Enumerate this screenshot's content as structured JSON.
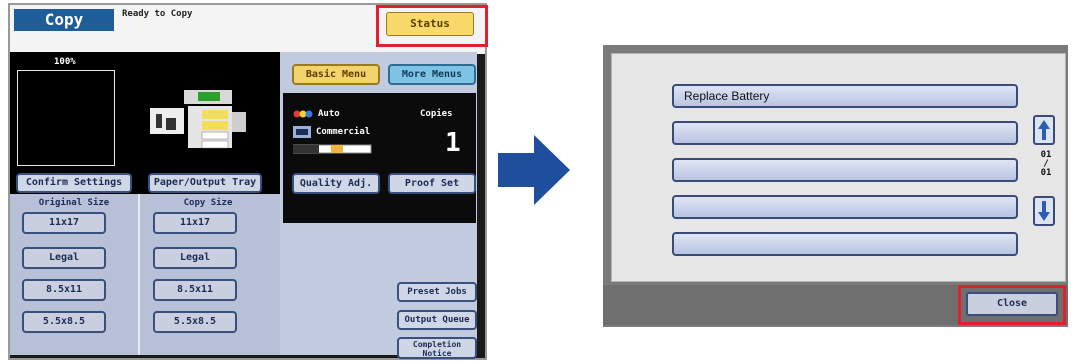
{
  "left_screen": {
    "title": "Copy",
    "status_text": "Ready to Copy",
    "status_button": "Status",
    "zoom": "100%",
    "confirm_settings": "Confirm Settings",
    "paper_output_tray": "Paper/Output Tray",
    "original_size_header": "Original Size",
    "copy_size_header": "Copy Size",
    "original_sizes": [
      "11x17",
      "Legal",
      "8.5x11",
      "5.5x8.5"
    ],
    "copy_sizes": [
      "11x17",
      "Legal",
      "8.5x11",
      "5.5x8.5"
    ],
    "basic_menu": "Basic Menu",
    "more_menus": "More Menus",
    "color_mode": "Auto",
    "paper_type": "Commercial",
    "copies_label": "Copies",
    "copies_value": "1",
    "quality_adj": "Quality Adj.",
    "proof_set": "Proof Set",
    "preset_jobs": "Preset Jobs",
    "output_queue": "Output Queue",
    "completion_notice": "Completion Notice"
  },
  "dialog": {
    "items": [
      "Replace Battery",
      "",
      "",
      "",
      ""
    ],
    "page_indicator": {
      "current": "01",
      "separator": "/",
      "total": "01"
    },
    "close_button": "Close"
  },
  "colors": {
    "highlight": "#e0202a",
    "arrow": "#1f4e9c",
    "copy_tab": "#1f5d99",
    "status_button": "#f8d96a"
  }
}
